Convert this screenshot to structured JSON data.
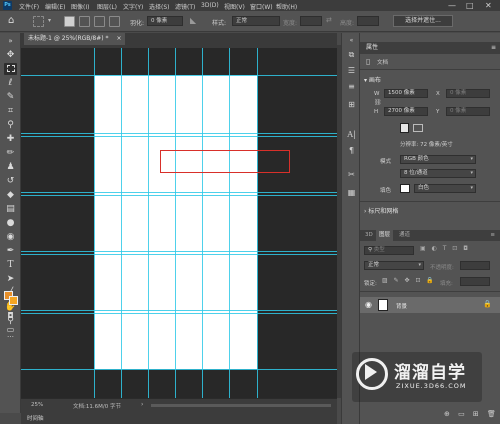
{
  "app": {
    "logo": "Ps"
  },
  "menu": [
    "文件(F)",
    "编辑(E)",
    "图像(I)",
    "图层(L)",
    "文字(Y)",
    "选择(S)",
    "滤镜(T)",
    "3D(D)",
    "视图(V)",
    "窗口(W)",
    "帮助(H)"
  ],
  "window_controls": {
    "minimize": "—",
    "maximize": "□",
    "close": "✕"
  },
  "options": {
    "feather_label": "羽化:",
    "feather_value": "0 像素",
    "style_label": "样式:",
    "style_value": "正常",
    "width_label": "宽度:",
    "height_label": "高度:",
    "select_mask": "选择并遮住..."
  },
  "document": {
    "tab_title": "未标题-1 @ 25%(RGB/8#) *",
    "close": "×",
    "zoom": "25%",
    "doc_info": "文档:11.6M/0 字节",
    "timeline": "时间轴"
  },
  "tools": [
    "move",
    "marquee",
    "lasso",
    "quick-select",
    "crop",
    "eyedropper",
    "healing",
    "brush",
    "stamp",
    "history-brush",
    "eraser",
    "gradient",
    "blur",
    "dodge",
    "pen",
    "type",
    "path-select",
    "rectangle",
    "hand",
    "zoom"
  ],
  "colors": {
    "foreground": "#e8902a",
    "background": "#f5a623",
    "guide": "#2fc9e8",
    "selection": "#d8302a"
  },
  "properties": {
    "title": "属性",
    "doc_label": "文档",
    "canvas_section": "画布",
    "w_label": "W",
    "w_value": "1500 像素",
    "x_label": "X",
    "x_placeholder": "0 像素",
    "h_label": "H",
    "h_value": "2700 像素",
    "y_label": "Y",
    "y_placeholder": "0 像素",
    "resolution": "分辨率: 72 像素/英寸",
    "mode_label": "模式",
    "mode_value": "RGB 颜色",
    "bits_value": "8 位/通道",
    "fill_label": "填色",
    "fill_value": "白色",
    "rulers_section": "标尺和网格"
  },
  "layers": {
    "tabs": [
      "3D",
      "图层",
      "通道"
    ],
    "active_tab": "图层",
    "search_placeholder": "类型",
    "blend_mode": "正常",
    "opacity_label": "不透明度:",
    "lock_label": "锁定:",
    "fill_label": "填充:",
    "layer_name": "背景"
  },
  "watermark": {
    "title": "溜溜自学",
    "url": "ZIXUE.3D66.COM"
  }
}
